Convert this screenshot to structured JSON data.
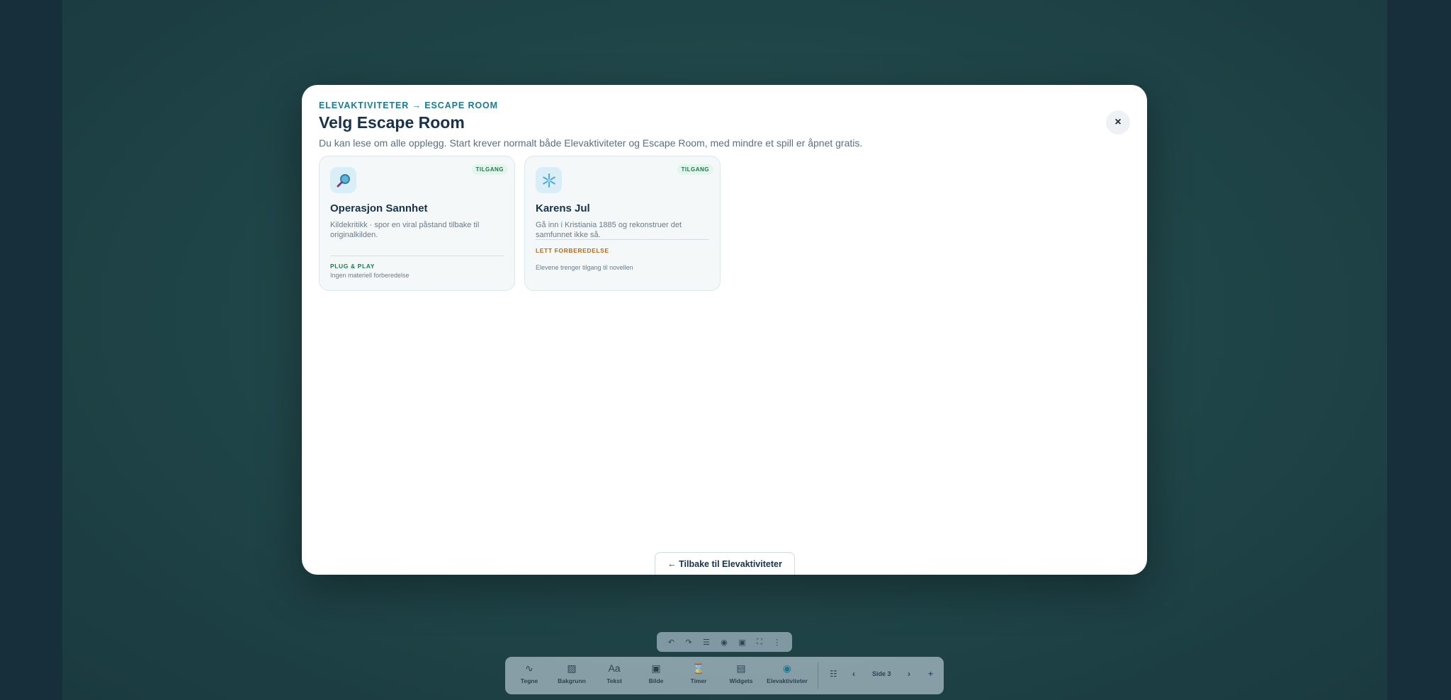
{
  "modal": {
    "breadcrumb": "ELEVAKTIVITETER → ESCAPE ROOM",
    "title": "Velg Escape Room",
    "subtitle": "Du kan lese om alle opplegg. Start krever normalt både Elevaktiviteter og Escape Room, med mindre et spill er åpnet gratis.",
    "close_label": "×",
    "back_label": "← Tilbake til Elevaktiviteter"
  },
  "cards": [
    {
      "icon": "magnifier-icon",
      "badge": "TILGANG",
      "title": "Operasjon Sannhet",
      "description": "Kildekritikk · spor en viral påstand tilbake til originalkilden.",
      "prep": "PLUG & PLAY",
      "note": "Ingen materiell forberedelse"
    },
    {
      "icon": "snowflake-icon",
      "badge": "TILGANG",
      "title": "Karens Jul",
      "description": "Gå inn i Kristiania 1885 og rekonstruer det samfunnet ikke så.",
      "prep": "LETT FORBEREDELSE",
      "note": "Elevene trenger tilgang til novellen"
    }
  ],
  "mini_toolbar": {
    "undo": "↶",
    "redo": "↷",
    "list": "☰",
    "record": "◉",
    "frame": "▣",
    "fullscreen": "⛶",
    "more": "⋮"
  },
  "toolbar": {
    "tools": [
      {
        "icon": "∿",
        "label": "Tegne"
      },
      {
        "icon": "▨",
        "label": "Bakgrunn"
      },
      {
        "icon": "Aa",
        "label": "Tekst"
      },
      {
        "icon": "▣",
        "label": "Bilde"
      },
      {
        "icon": "⌛",
        "label": "Timer"
      },
      {
        "icon": "▤",
        "label": "Widgets"
      },
      {
        "icon": "◉",
        "label": "Elevaktiviteter"
      }
    ],
    "grid_icon": "☷",
    "prev": "‹",
    "page_label": "Side 3",
    "next": "›",
    "add": "+"
  },
  "colors": {
    "accent": "#1b7a93",
    "title": "#17324a",
    "badge_green": "#1e7a4f",
    "prep_orange": "#b56a1a"
  }
}
